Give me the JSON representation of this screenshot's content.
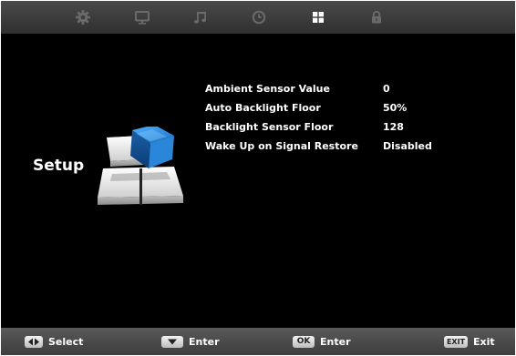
{
  "tabs": [
    {
      "icon": "gear-icon"
    },
    {
      "icon": "monitor-icon"
    },
    {
      "icon": "music-note-icon"
    },
    {
      "icon": "clock-icon"
    },
    {
      "icon": "grid-icon",
      "selected": true
    },
    {
      "icon": "lock-icon"
    }
  ],
  "menu": {
    "title": "Setup",
    "items": [
      {
        "label": "Ambient Sensor Value",
        "value": "0"
      },
      {
        "label": "Auto Backlight Floor",
        "value": "50%"
      },
      {
        "label": "Backlight Sensor Floor",
        "value": "128"
      },
      {
        "label": "Wake Up on Signal Restore",
        "value": "Disabled"
      }
    ]
  },
  "footer": {
    "select": {
      "key_icon": "left-right-arrows-icon",
      "label": "Select"
    },
    "enter_down": {
      "key_icon": "down-arrow-icon",
      "label": "Enter"
    },
    "ok": {
      "key": "OK",
      "label": "Enter"
    },
    "exit": {
      "key": "EXIT",
      "label": "Exit"
    }
  },
  "colors": {
    "background": "#000000",
    "bar": "#444444",
    "icon_inactive": "#6a6a6a",
    "icon_active": "#ffffff",
    "accent_blue": "#1e74c8"
  }
}
